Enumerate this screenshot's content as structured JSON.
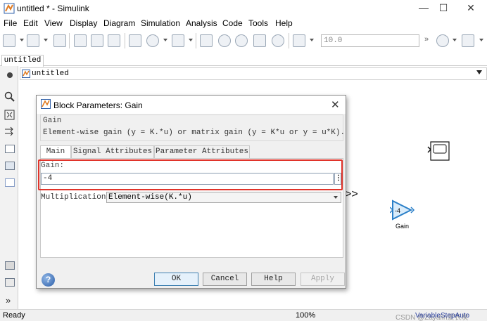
{
  "window": {
    "title": "untitled * - Simulink",
    "controls": [
      "—",
      "☐",
      "✕"
    ]
  },
  "menu": [
    "File",
    "Edit",
    "View",
    "Display",
    "Diagram",
    "Simulation",
    "Analysis",
    "Code",
    "Tools",
    "Help"
  ],
  "toolbar": {
    "stop_time": "10.0"
  },
  "model_tab": "untitled",
  "breadcrumb": "untitled",
  "dialog": {
    "title": "Block Parameters: Gain",
    "group_title": "Gain",
    "description": "Element-wise gain (y = K.*u) or matrix gain (y = K*u or y = u*K).",
    "tabs": [
      "Main",
      "Signal Attributes",
      "Parameter Attributes"
    ],
    "gain_label": "Gain:",
    "gain_value": "-4",
    "more_button": "⋮",
    "multiplication_label": "Multiplication:",
    "multiplication_value": "Element-wise(K.*u)",
    "buttons": {
      "ok": "OK",
      "cancel": "Cancel",
      "help": "Help",
      "apply": "Apply"
    }
  },
  "canvas": {
    "gain_block_value": "-4",
    "gain_block_label": "Gain"
  },
  "status": {
    "left": "Ready",
    "zoom": "100%",
    "solver": "VariableStepAuto",
    "watermark": "CSDN @Zayalin爱农炭"
  },
  "colors": {
    "highlight": "#e0332a",
    "block_blue": "#2a7fc8",
    "solver_text": "#2a3f9c"
  }
}
